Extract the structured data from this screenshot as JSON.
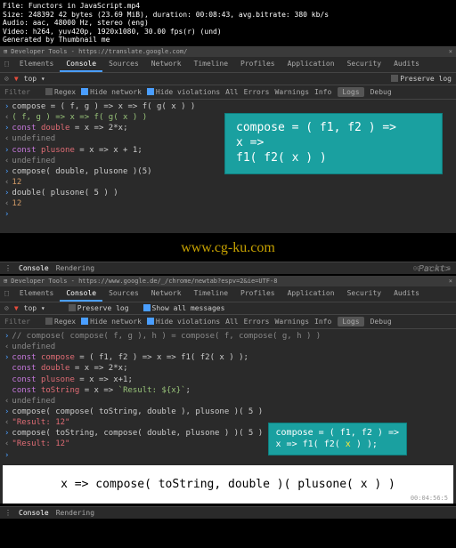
{
  "file_info": {
    "l1": "File: Functors in JavaScript.mp4",
    "l2": "Size: 248392 42 bytes (23.69 MiB), duration: 00:08:43, avg.bitrate: 380 kb/s",
    "l3": "Audio: aac, 48000 Hz, stereo (eng)",
    "l4": "Video: h264, yuv420p, 1920x1080, 30.00 fps(r) (und)",
    "l5": "Generated by Thumbnail me"
  },
  "devtools": {
    "title": "Developer Tools - https://translate.google.com/",
    "title2": "Developer Tools - https://www.google.de/_/chrome/newtab?espv=2&ie=UTF-8",
    "tabs": [
      "Elements",
      "Console",
      "Sources",
      "Network",
      "Timeline",
      "Profiles",
      "Application",
      "Security",
      "Audits"
    ],
    "top": "top",
    "preserve": "Preserve log",
    "filter": "Filter",
    "regex": "Regex",
    "hide_net": "Hide network",
    "hide_vio": "Hide violations",
    "all": "All",
    "errors": "Errors",
    "warnings": "Warnings",
    "info": "Info",
    "logs": "Logs",
    "debug": "Debug",
    "show_all": "Show all messages",
    "bottom": {
      "console": "Console",
      "rendering": "Rendering"
    }
  },
  "console1": {
    "l1": "compose = ( f, g ) => x => f( g( x ) )",
    "l2": "( f, g ) => x => f( g( x ) )",
    "l3a": "const ",
    "l3b": "double",
    "l3c": " = x => 2",
    "l3d": "*x;",
    "l4": "undefined",
    "l5a": "const ",
    "l5b": "plusone",
    "l5c": " = x => x + 1;",
    "l6": "undefined",
    "l7": "compose( double, plusone )(5)",
    "l8": "12",
    "l9": "double( plusone( 5 ) )",
    "l10": "12"
  },
  "callout1": {
    "l1": "compose = ( f1, f2 ) =>",
    "l2": "x =>",
    "l3": "f1( f2( x ) )"
  },
  "watermark": "www.cg-ku.com",
  "packt": "Packt>",
  "ts1": "00:01:31:8",
  "ts2": "00:04:56:5",
  "console2": {
    "l0": "// compose( compose( f, g ), h ) = compose( f, compose( g, h ) )",
    "l1": "undefined",
    "l2a": "const ",
    "l2b": "compose",
    "l2c": " = ( f1, f2 ) => x => f1( f2( x ) );",
    "l3a": "const ",
    "l3b": "double",
    "l3c": " = x => 2",
    "l3d": "*x;",
    "l4a": "const ",
    "l4b": "plusone",
    "l4c": " = x => x+1;",
    "l5a": "const ",
    "l5b": "toString",
    "l5c": " = x => ",
    "l5d": "`Result: ${x}`",
    "l5e": ";",
    "l6": "undefined",
    "l7": "compose( compose( toString, double ), plusone )( 5 )",
    "l8": "\"Result: 12\"",
    "l9": "compose( toString, compose( double, plusone ) )( 5 )",
    "l10": "\"Result: 12\""
  },
  "callout2": {
    "l1": "compose = ( f1, f2 ) =>",
    "l2a": "  x => f1( f2( ",
    "l2b": "x",
    "l2c": " ) );"
  },
  "whitebox": "x => compose( toString, double )( plusone( x ) )"
}
